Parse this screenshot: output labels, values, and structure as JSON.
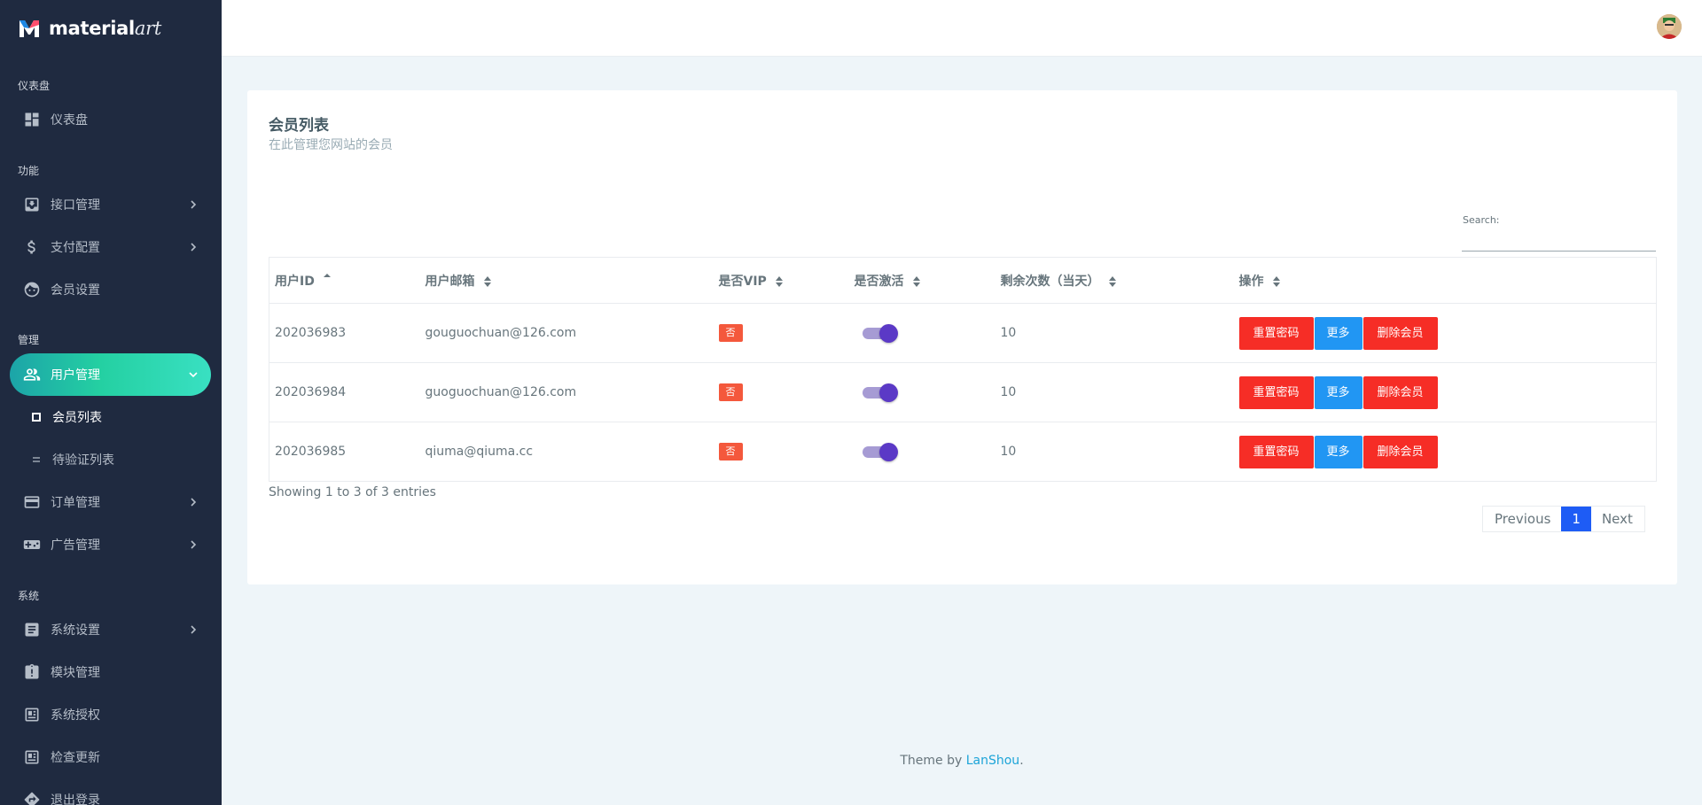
{
  "brand": {
    "name_bold": "material",
    "name_italic": "art"
  },
  "sidebar": {
    "sections": [
      {
        "caption": "仪表盘"
      },
      {
        "caption": "功能"
      },
      {
        "caption": "管理"
      },
      {
        "caption": "系统"
      }
    ],
    "items": [
      {
        "label": "仪表盘",
        "icon": "dashboard-icon"
      },
      {
        "label": "接口管理",
        "icon": "inbox-icon"
      },
      {
        "label": "支付配置",
        "icon": "dollar-icon"
      },
      {
        "label": "会员设置",
        "icon": "face-icon"
      },
      {
        "label": "用户管理",
        "icon": "people-icon"
      },
      {
        "label": "订单管理",
        "icon": "credit-card-icon"
      },
      {
        "label": "广告管理",
        "icon": "gamepad-icon"
      },
      {
        "label": "系统设置",
        "icon": "article-icon"
      },
      {
        "label": "模块管理",
        "icon": "clipboard-alert-icon"
      },
      {
        "label": "系统授权",
        "icon": "newspaper-icon"
      },
      {
        "label": "检查更新",
        "icon": "newspaper-icon"
      },
      {
        "label": "退出登录",
        "icon": "logout-icon"
      }
    ],
    "subitems": [
      {
        "label": "会员列表"
      },
      {
        "label": "待验证列表"
      }
    ]
  },
  "card": {
    "title": "会员列表",
    "subtitle": "在此管理您网站的会员",
    "search_label": "Search:",
    "search_value": ""
  },
  "table": {
    "headers": [
      "用户ID",
      "用户邮箱",
      "是否VIP",
      "是否激活",
      "剩余次数（当天）",
      "操作"
    ],
    "rows": [
      {
        "id": "202036983",
        "email": "gouguochuan@126.com",
        "vip": "否",
        "active": true,
        "remaining": "10"
      },
      {
        "id": "202036984",
        "email": "guoguochuan@126.com",
        "vip": "否",
        "active": true,
        "remaining": "10"
      },
      {
        "id": "202036985",
        "email": "qiuma@qiuma.cc",
        "vip": "否",
        "active": true,
        "remaining": "10"
      }
    ],
    "actions": {
      "reset": "重置密码",
      "more": "更多",
      "delete": "删除会员"
    }
  },
  "info": "Showing 1 to 3 of 3 entries",
  "pagination": {
    "previous": "Previous",
    "current": "1",
    "next": "Next"
  },
  "footer": {
    "prefix": "Theme by ",
    "link": "LanShou",
    "suffix": "."
  },
  "colors": {
    "sidebar_bg": "#1f2a40",
    "active_gradient_start": "#1ca4a8",
    "active_gradient_end": "#39e0c2",
    "danger": "#f62d26",
    "info": "#2196f3",
    "badge": "#f4583c",
    "page_current": "#1e5cf5"
  }
}
